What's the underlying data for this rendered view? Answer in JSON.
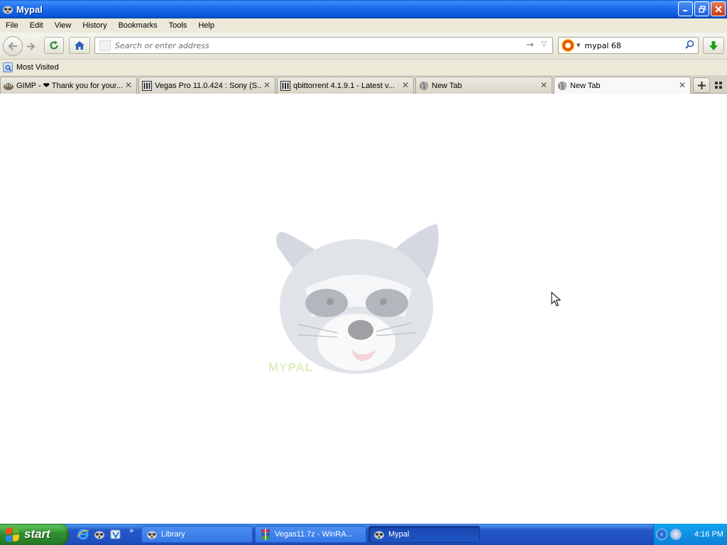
{
  "window": {
    "title": "Mypal"
  },
  "menu": [
    "File",
    "Edit",
    "View",
    "History",
    "Bookmarks",
    "Tools",
    "Help"
  ],
  "navigation": {
    "address_placeholder": "Search or enter address",
    "search_value": "mypal 68"
  },
  "bookmarks": {
    "most_visited": "Most Visited"
  },
  "tabs": [
    {
      "label": "GIMP - ❤ Thank you for your...",
      "icon": "gimp-icon"
    },
    {
      "label": "Vegas Pro 11.0.424 : Sony (S...",
      "icon": "archive-icon"
    },
    {
      "label": "qbittorrent 4.1.9.1 - Latest v...",
      "icon": "archive-icon"
    },
    {
      "label": "New Tab",
      "icon": "globe-icon"
    },
    {
      "label": "New Tab",
      "icon": "globe-icon",
      "active": true
    }
  ],
  "content": {
    "watermark_text": "MYPAL"
  },
  "taskbar": {
    "start_label": "start",
    "tasks": [
      {
        "label": "Library",
        "icon": "raccoon-icon"
      },
      {
        "label": "Vegas11.7z - WinRA...",
        "icon": "winrar-icon"
      },
      {
        "label": "Mypal",
        "icon": "raccoon-icon",
        "active": true
      }
    ],
    "clock": "4:16 PM"
  },
  "colors": {
    "titlebar": "#0a56d8",
    "chrome": "#ece9d8",
    "taskbar": "#1e4fc0",
    "start": "#2f8f2f",
    "tray": "#0c7fd8"
  }
}
